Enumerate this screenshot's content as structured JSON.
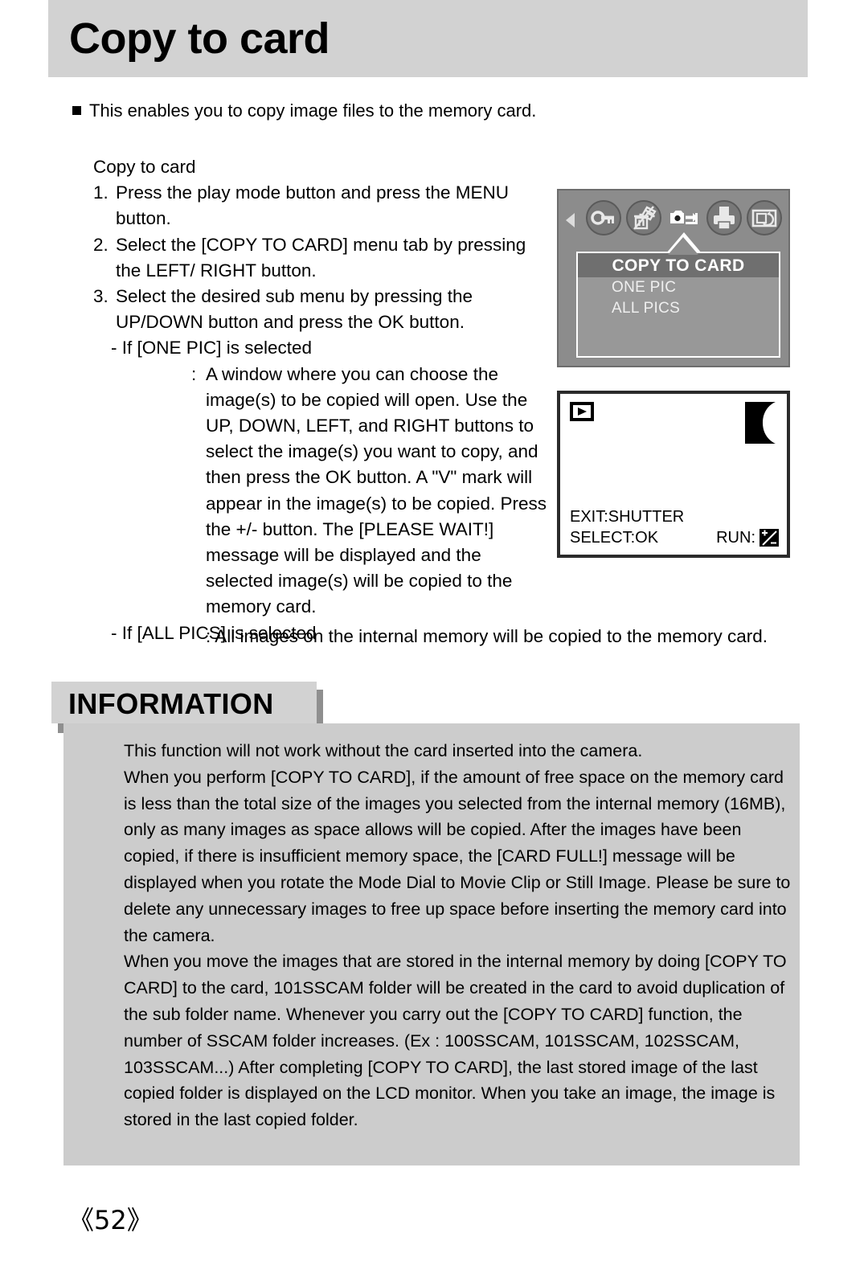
{
  "header": {
    "title": "Copy to card"
  },
  "intro": {
    "bullet_text": "This enables you to copy image files to the memory card."
  },
  "steps": {
    "lead": "Copy to card",
    "items": [
      {
        "num": "1.",
        "text": "Press the play mode button and press the MENU button."
      },
      {
        "num": "2.",
        "text": "Select the [COPY TO CARD] menu tab by pressing the LEFT/ RIGHT button."
      },
      {
        "num": "3.",
        "text": "Select the desired sub menu by pressing the UP/DOWN button and press the OK button."
      }
    ],
    "one_pic_dash": "- If [ONE PIC] is selected",
    "one_pic_detail": "A window where you can choose the image(s) to be copied will open. Use the UP, DOWN, LEFT, and RIGHT buttons to select the image(s) you want to copy, and then press the OK button. A \"V\" mark will appear in the image(s) to be copied. Press the +/- button. The [PLEASE WAIT!] message will be displayed and the selected image(s) will be copied to the memory card.",
    "all_pics_dash": "- If [ALL PICS] is selected",
    "all_pics_detail": ": All images on the internal memory will be copied to the memory card.",
    "colon": ":"
  },
  "lcd_menu": {
    "tabs": [
      {
        "icon": "key-icon",
        "name": "protect-tab",
        "selected": false
      },
      {
        "icon": "trash-icon",
        "name": "delete-tab",
        "selected": false
      },
      {
        "icon": "copy-to-card-icon",
        "name": "copy-to-card-tab",
        "selected": true
      },
      {
        "icon": "printer-icon",
        "name": "dpof-tab",
        "selected": false
      },
      {
        "icon": "slideshow-icon",
        "name": "slideshow-tab",
        "selected": false
      }
    ],
    "arrow_left": "left-arrow-icon",
    "arrow_right": "right-arrow-icon",
    "title": "COPY TO CARD",
    "options": [
      "ONE PIC",
      "ALL PICS"
    ],
    "colors": {
      "screen_bg": "#8c8c8c",
      "panel_bg": "#989898",
      "title_bg": "#6f6f6f",
      "title_fg": "#ffffff"
    }
  },
  "lcd_copy_view": {
    "play_icon": "play-mode-icon",
    "thumb_icon": "image-thumbnail",
    "exit_hint": "EXIT:SHUTTER",
    "select_hint": "SELECT:OK",
    "run_label": "RUN:",
    "run_icon": "plus-minus-icon"
  },
  "information": {
    "band_label": "INFORMATION",
    "paragraphs": [
      "This function will not work without the card inserted into the camera.",
      "When you perform [COPY TO CARD], if the amount of free space on the memory card is less than the total size of the images you selected from the internal memory (16MB), only as many images as space allows will be copied. After the images have been copied, if there is insufficient memory space, the [CARD FULL!] message will be displayed when you rotate the Mode Dial to Movie Clip or Still Image. Please be sure to delete any unnecessary images to free up space before inserting the memory card into the camera.",
      "When you move the images that are stored in the internal memory by doing [COPY TO CARD] to the card, 101SSCAM folder will be created in the card to avoid duplication of the sub folder name. Whenever you carry out the [COPY TO CARD] function, the number of SSCAM folder increases. (Ex : 100SSCAM, 101SSCAM, 102SSCAM, 103SSCAM...) After completing [COPY TO CARD], the last stored image of the last copied folder is displayed on the LCD monitor. When you take an image, the image is stored in the last copied folder."
    ]
  },
  "footer": {
    "page_number": "《52》"
  }
}
